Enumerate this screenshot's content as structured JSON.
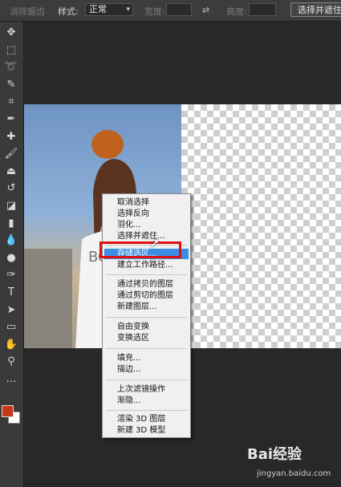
{
  "options_bar": {
    "antialias_label": "消除锯齿",
    "style_label": "样式:",
    "style_value": "正常",
    "width_label": "宽度:",
    "height_label": "高度:",
    "select_and_mask": "选择并遮住"
  },
  "tools": [
    "move-icon",
    "marquee-icon",
    "lasso-icon",
    "quick-select-icon",
    "crop-icon",
    "eyedropper-icon",
    "healing-icon",
    "brush-icon",
    "stamp-icon",
    "history-brush-icon",
    "eraser-icon",
    "gradient-icon",
    "blur-icon",
    "dodge-icon",
    "pen-icon",
    "type-icon",
    "path-select-icon",
    "shape-icon",
    "hand-icon",
    "zoom-icon",
    "more-icon"
  ],
  "colors": {
    "foreground": "#c8391a",
    "background": "#ffffff",
    "highlight": "#3a8ee6",
    "annotation": "#e01010"
  },
  "context_menu": {
    "groups": [
      [
        "取消选择",
        "选择反向",
        "羽化...",
        "选择并遮住..."
      ],
      [
        "存储选区...",
        "建立工作路径..."
      ],
      [
        "通过拷贝的图层",
        "通过剪切的图层",
        "新建图层..."
      ],
      [
        "自由变换",
        "变换选区"
      ],
      [
        "填充...",
        "描边..."
      ],
      [
        "上次滤镜操作",
        "渐隐..."
      ],
      [
        "渲染 3D 图层",
        "新建 3D 模型"
      ]
    ],
    "highlighted": "存储选区..."
  },
  "watermark": {
    "brand": "Bai经验",
    "url": "jingyan.baidu.com"
  }
}
